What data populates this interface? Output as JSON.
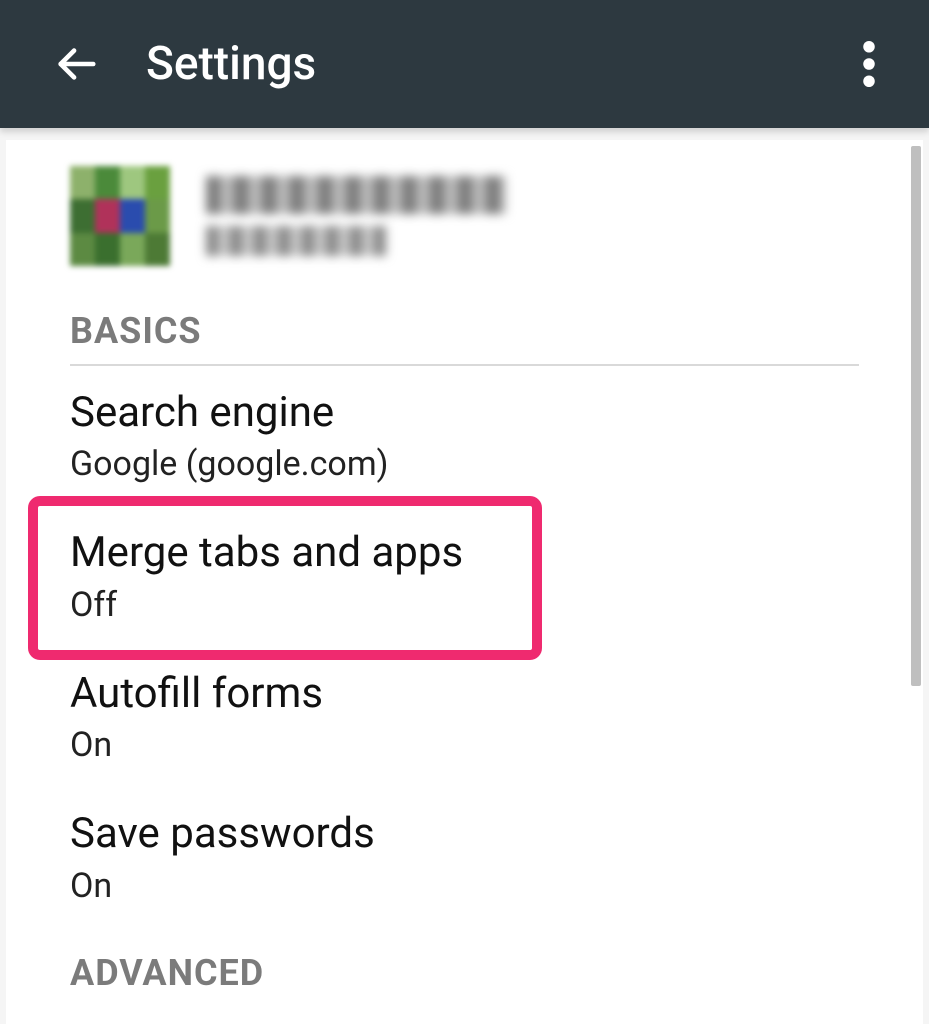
{
  "header": {
    "title": "Settings"
  },
  "sections": {
    "basics_label": "BASICS",
    "advanced_label": "ADVANCED"
  },
  "settings": {
    "search_engine": {
      "title": "Search engine",
      "value": "Google (google.com)"
    },
    "merge_tabs": {
      "title": "Merge tabs and apps",
      "value": "Off"
    },
    "autofill": {
      "title": "Autofill forms",
      "value": "On"
    },
    "save_passwords": {
      "title": "Save passwords",
      "value": "On"
    }
  },
  "highlight": {
    "target": "merge_tabs"
  }
}
